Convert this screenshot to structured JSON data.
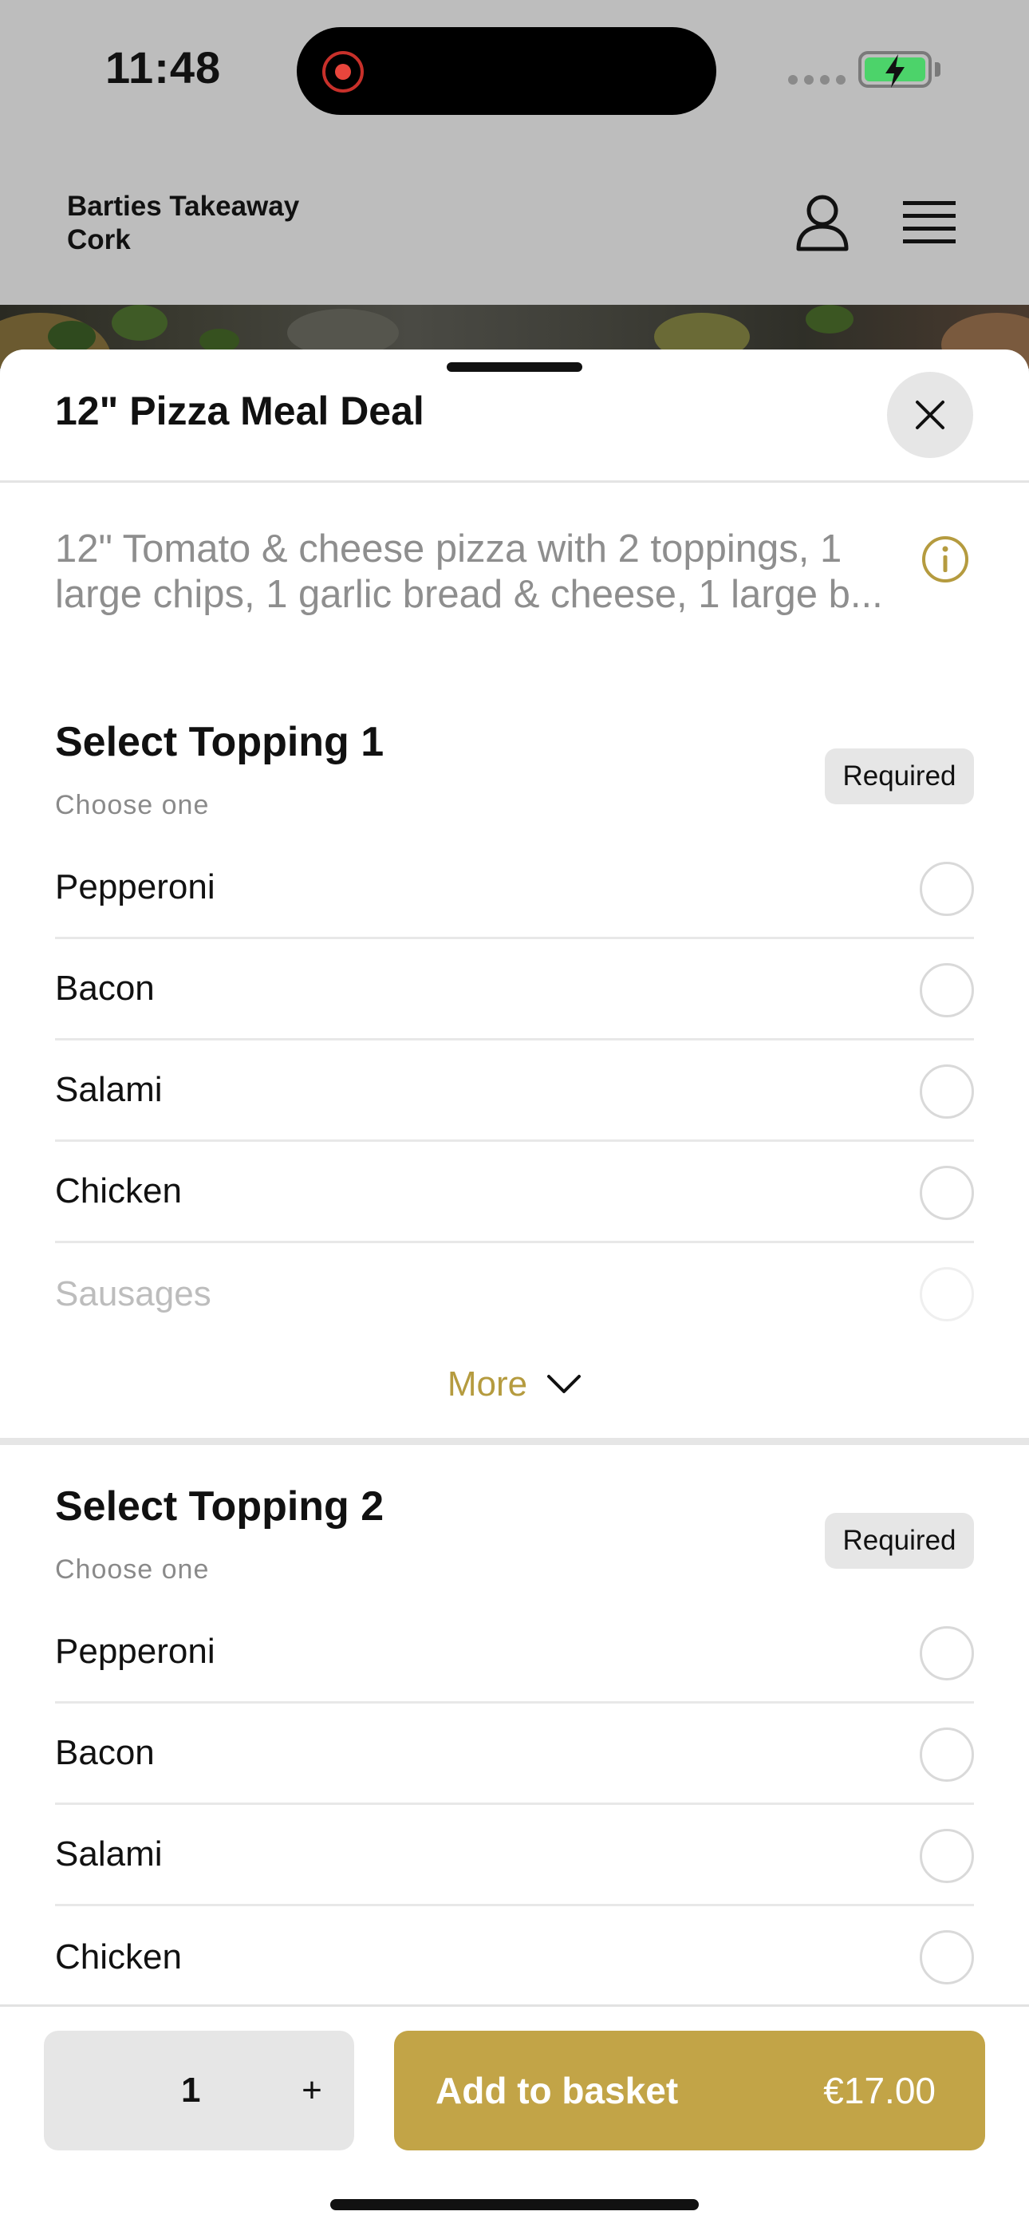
{
  "status_bar": {
    "time": "11:48",
    "recording_icon": "screen-recording-icon",
    "signal_icon": "cellular-signal-icon",
    "battery_icon": "battery-charging-icon",
    "battery_color": "#4cd36a"
  },
  "header": {
    "restaurant_name": "Barties Takeaway Cork",
    "account_icon": "user-icon",
    "menu_icon": "hamburger-menu-icon"
  },
  "sheet": {
    "title": "12\" Pizza Meal Deal",
    "close_icon": "close-icon",
    "description": "12\" Tomato & cheese pizza with 2 toppings, 1 large chips, 1 garlic bread & cheese, 1 large b...",
    "info_icon": "info-icon",
    "accent_color": "#c2a447"
  },
  "sections": [
    {
      "title": "Select Topping 1",
      "subtitle": "Choose one",
      "badge": "Required",
      "options": [
        "Pepperoni",
        "Bacon",
        "Salami",
        "Chicken",
        "Sausages"
      ],
      "more_label": "More",
      "more_icon": "chevron-down-icon"
    },
    {
      "title": "Select Topping 2",
      "subtitle": "Choose one",
      "badge": "Required",
      "options": [
        "Pepperoni",
        "Bacon",
        "Salami",
        "Chicken"
      ]
    }
  ],
  "footer": {
    "quantity": "1",
    "plus_label": "+",
    "add_label": "Add to basket",
    "price": "€17.00"
  }
}
